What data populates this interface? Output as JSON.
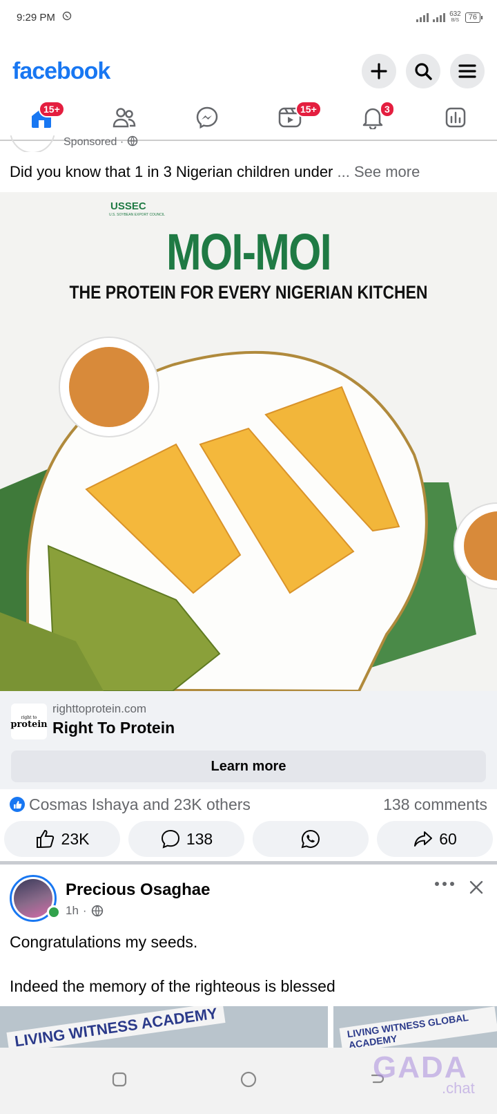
{
  "status_bar": {
    "time": "9:29 PM",
    "net_speed": "632",
    "net_unit": "B/S",
    "battery": "76"
  },
  "header": {
    "logo": "facebook",
    "icons": [
      "plus-icon",
      "search-icon",
      "menu-icon"
    ]
  },
  "nav": {
    "tabs": [
      {
        "name": "home",
        "badge": "15+"
      },
      {
        "name": "friends",
        "badge": ""
      },
      {
        "name": "messenger",
        "badge": ""
      },
      {
        "name": "video",
        "badge": "15+"
      },
      {
        "name": "notifications",
        "badge": "3"
      },
      {
        "name": "dashboard",
        "badge": ""
      }
    ]
  },
  "post1": {
    "sponsored_label": "Sponsored",
    "text": "Did you know that 1 in 3 Nigerian children under",
    "see_more": "... See more",
    "image": {
      "brand": "USSEC",
      "brand_sub": "U.S. SOYBEAN EXPORT COUNCIL",
      "title": "MOI-MOI",
      "subtitle": "THE PROTEIN FOR EVERY NIGERIAN KITCHEN"
    },
    "link": {
      "logo_text": "protein",
      "logo_small": "right to",
      "domain": "righttoprotein.com",
      "title": "Right To Protein",
      "button": "Learn more"
    },
    "reactions_text": "Cosmas Ishaya and 23K others",
    "comments_text": "138 comments",
    "actions": {
      "like": "23K",
      "comment": "138",
      "share": "60"
    }
  },
  "post2": {
    "author": "Precious Osaghae",
    "time": "1h",
    "line1": "Congratulations my seeds.",
    "line2": "Indeed the memory of the righteous is blessed",
    "photo1_sign": "LIVING WITNESS ACADEMY",
    "photo2_sign": "LIVING WITNESS GLOBAL ACADEMY"
  },
  "watermark": {
    "text": "GADA",
    "sub": ".chat"
  }
}
